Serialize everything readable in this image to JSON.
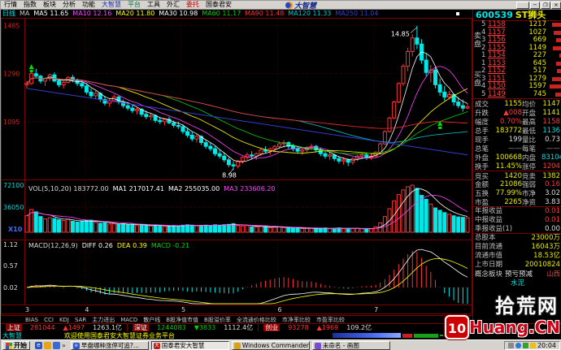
{
  "menu": {
    "items": [
      {
        "label": "行情",
        "color": "#000000"
      },
      {
        "label": "指数",
        "color": "#000000"
      },
      {
        "label": "板块",
        "color": "#000000"
      },
      {
        "label": "分析",
        "color": "#000000"
      },
      {
        "label": "功能",
        "color": "#000000"
      },
      {
        "label": "大智慧",
        "color": "#1a2fb0"
      },
      {
        "label": "平台",
        "color": "#0a7a4a"
      },
      {
        "label": "工具",
        "color": "#000000"
      },
      {
        "label": "外汇",
        "color": "#000000"
      },
      {
        "label": "委托",
        "color": "#c00000"
      },
      {
        "label": "国泰君安",
        "color": "#000000"
      }
    ],
    "brand": "大智慧",
    "window_buttons": {
      "minimize": "─",
      "restore": "❐",
      "close": "✕"
    }
  },
  "chart": {
    "period": "日线",
    "ma_legend": [
      {
        "t": "MA",
        "c": "#c8c8c8"
      },
      {
        "t": "MA5 11.65",
        "c": "#ffffff"
      },
      {
        "t": "MA10 12.16",
        "c": "#ff45ff"
      },
      {
        "t": "MA20 11.80",
        "c": "#ffff00"
      },
      {
        "t": "MA30 10.98",
        "c": "#ffffff"
      },
      {
        "t": "MA60 11.17",
        "c": "#00d000"
      },
      {
        "t": "MA90 11.48",
        "c": "#ff3030"
      },
      {
        "t": "MA120 11.33",
        "c": "#00c8c8"
      },
      {
        "t": "MA250 11.04",
        "c": "#2f3fd0"
      }
    ],
    "vol_legend": [
      {
        "t": "VOL(5,10,20) 183772.00",
        "c": "#d8d8d8"
      },
      {
        "t": "MA1 217017.41",
        "c": "#ffffff"
      },
      {
        "t": "MA2 255035.00",
        "c": "#ffffff"
      },
      {
        "t": "MA3 233606.20",
        "c": "#ff45ff"
      }
    ],
    "macd_legend": [
      {
        "t": "MACD(12,26,9)",
        "c": "#d8d8d8"
      },
      {
        "t": "DIFF 0.26",
        "c": "#ffffff"
      },
      {
        "t": "DEA 0.39",
        "c": "#ffff00"
      },
      {
        "t": "MACD -0.21",
        "c": "#00d000"
      }
    ],
    "price_axis": [
      {
        "t": "1485",
        "p": 14.85
      },
      {
        "t": "1290",
        "p": 12.9
      },
      {
        "t": "1095",
        "p": 10.95
      }
    ],
    "vol_axis": [
      "72100",
      "36050"
    ],
    "vol_mult": "X10",
    "macd_axis": [
      "1.12",
      "0.57",
      "0.02"
    ]
  },
  "chart_data": {
    "type": "candlestick",
    "title": "600539 ST狮头 日线",
    "ylim": [
      8.8,
      15.1
    ],
    "months": [
      {
        "label": "3",
        "i": 0
      },
      {
        "label": "4",
        "i": 13
      },
      {
        "label": "5",
        "i": 34
      },
      {
        "label": "6",
        "i": 55
      },
      {
        "label": "7",
        "i": 76
      }
    ],
    "annotations": [
      {
        "t": "14.85",
        "day": 85,
        "kind": "high"
      },
      {
        "t": "8.98",
        "day": 45,
        "kind": "low"
      }
    ],
    "markers": [
      {
        "day": 1,
        "price": 13.15
      },
      {
        "day": 90,
        "price": 10.85
      }
    ],
    "ma250_line": [
      [
        0,
        12.3
      ],
      [
        96,
        9.6
      ]
    ],
    "candles": [
      [
        12.45,
        12.6,
        12.3,
        12.5,
        210
      ],
      [
        12.5,
        12.95,
        12.45,
        12.9,
        290
      ],
      [
        12.9,
        13.1,
        12.7,
        12.8,
        260
      ],
      [
        12.8,
        12.85,
        12.5,
        12.6,
        200
      ],
      [
        12.6,
        12.75,
        12.4,
        12.7,
        170
      ],
      [
        12.7,
        12.9,
        12.6,
        12.85,
        185
      ],
      [
        12.85,
        12.95,
        12.55,
        12.6,
        175
      ],
      [
        12.6,
        12.7,
        12.35,
        12.45,
        160
      ],
      [
        12.45,
        12.6,
        12.3,
        12.55,
        150
      ],
      [
        12.55,
        12.8,
        12.5,
        12.75,
        165
      ],
      [
        12.75,
        12.85,
        12.55,
        12.65,
        140
      ],
      [
        12.65,
        12.7,
        12.4,
        12.5,
        130
      ],
      [
        12.5,
        12.6,
        12.3,
        12.4,
        135
      ],
      [
        12.4,
        12.5,
        12.05,
        12.15,
        150
      ],
      [
        12.15,
        12.3,
        11.9,
        12.0,
        155
      ],
      [
        12.0,
        12.2,
        11.85,
        12.1,
        125
      ],
      [
        12.1,
        12.15,
        11.75,
        11.85,
        115
      ],
      [
        11.85,
        12.0,
        11.6,
        11.7,
        120
      ],
      [
        11.7,
        11.9,
        11.55,
        11.8,
        105
      ],
      [
        11.8,
        12.05,
        11.75,
        11.95,
        110
      ],
      [
        11.95,
        12.0,
        11.65,
        11.75,
        100
      ],
      [
        11.75,
        11.85,
        11.5,
        11.6,
        105
      ],
      [
        11.6,
        11.75,
        11.4,
        11.5,
        95
      ],
      [
        11.5,
        11.65,
        11.3,
        11.4,
        100
      ],
      [
        11.4,
        11.55,
        11.25,
        11.45,
        85
      ],
      [
        11.45,
        11.5,
        11.15,
        11.25,
        95
      ],
      [
        11.25,
        11.4,
        11.05,
        11.15,
        90
      ],
      [
        11.15,
        11.3,
        11.0,
        11.2,
        80
      ],
      [
        11.2,
        11.25,
        10.9,
        11.0,
        90
      ],
      [
        11.0,
        11.15,
        10.85,
        10.95,
        85
      ],
      [
        10.95,
        11.1,
        10.8,
        11.05,
        75
      ],
      [
        11.05,
        11.15,
        10.85,
        10.9,
        80
      ],
      [
        10.9,
        11.0,
        10.7,
        10.8,
        85
      ],
      [
        10.8,
        10.95,
        10.65,
        10.75,
        80
      ],
      [
        10.75,
        10.85,
        10.45,
        10.55,
        90
      ],
      [
        10.55,
        10.7,
        10.3,
        10.4,
        95
      ],
      [
        10.4,
        10.55,
        10.15,
        10.25,
        90
      ],
      [
        10.25,
        10.45,
        10.1,
        10.35,
        80
      ],
      [
        10.35,
        10.4,
        10.0,
        10.1,
        85
      ],
      [
        10.1,
        10.2,
        9.85,
        9.95,
        90
      ],
      [
        9.95,
        10.1,
        9.75,
        9.85,
        85
      ],
      [
        9.85,
        9.95,
        9.55,
        9.65,
        95
      ],
      [
        9.65,
        9.8,
        9.45,
        9.55,
        90
      ],
      [
        9.55,
        9.7,
        9.3,
        9.4,
        95
      ],
      [
        9.4,
        9.5,
        9.1,
        9.2,
        100
      ],
      [
        9.2,
        9.35,
        8.98,
        9.15,
        110
      ],
      [
        9.15,
        9.4,
        9.05,
        9.35,
        85
      ],
      [
        9.35,
        9.55,
        9.25,
        9.5,
        80
      ],
      [
        9.5,
        9.7,
        9.4,
        9.6,
        85
      ],
      [
        9.6,
        9.75,
        9.45,
        9.55,
        70
      ],
      [
        9.55,
        9.7,
        9.4,
        9.65,
        65
      ],
      [
        9.65,
        9.85,
        9.55,
        9.8,
        75
      ],
      [
        9.8,
        9.95,
        9.65,
        9.75,
        70
      ],
      [
        9.75,
        9.9,
        9.6,
        9.85,
        60
      ],
      [
        9.85,
        10.0,
        9.7,
        9.95,
        65
      ],
      [
        9.95,
        10.15,
        9.85,
        10.05,
        70
      ],
      [
        10.05,
        10.2,
        9.9,
        10.1,
        60
      ],
      [
        10.1,
        10.15,
        9.85,
        9.95,
        55
      ],
      [
        9.95,
        10.05,
        9.75,
        9.85,
        50
      ],
      [
        9.85,
        9.95,
        9.65,
        9.75,
        55
      ],
      [
        9.75,
        9.9,
        9.6,
        9.8,
        48
      ],
      [
        9.8,
        9.95,
        9.7,
        9.9,
        50
      ],
      [
        9.9,
        10.05,
        9.8,
        9.95,
        52
      ],
      [
        9.95,
        10.0,
        9.7,
        9.8,
        45
      ],
      [
        9.8,
        9.9,
        9.55,
        9.65,
        50
      ],
      [
        9.65,
        9.75,
        9.45,
        9.55,
        55
      ],
      [
        9.55,
        9.7,
        9.4,
        9.6,
        45
      ],
      [
        9.6,
        9.65,
        9.35,
        9.45,
        50
      ],
      [
        9.45,
        9.55,
        9.25,
        9.35,
        55
      ],
      [
        9.35,
        9.5,
        9.2,
        9.4,
        45
      ],
      [
        9.4,
        9.45,
        9.15,
        9.3,
        50
      ],
      [
        9.3,
        9.5,
        9.2,
        9.45,
        48
      ],
      [
        9.45,
        9.6,
        9.35,
        9.55,
        50
      ],
      [
        9.55,
        9.7,
        9.45,
        9.6,
        45
      ],
      [
        9.6,
        9.7,
        9.4,
        9.5,
        42
      ],
      [
        9.5,
        9.65,
        9.4,
        9.55,
        45
      ],
      [
        9.55,
        9.75,
        9.5,
        9.7,
        70
      ],
      [
        9.7,
        10.1,
        9.65,
        10.05,
        120
      ],
      [
        10.05,
        10.6,
        10.0,
        10.55,
        200
      ],
      [
        10.55,
        11.15,
        10.5,
        11.1,
        300
      ],
      [
        11.1,
        11.8,
        11.05,
        11.75,
        400
      ],
      [
        11.75,
        12.55,
        11.7,
        12.5,
        480
      ],
      [
        12.5,
        13.3,
        12.4,
        13.2,
        540
      ],
      [
        13.2,
        13.95,
        13.0,
        13.8,
        580
      ],
      [
        13.8,
        14.5,
        13.6,
        14.35,
        600
      ],
      [
        14.35,
        14.85,
        13.9,
        14.1,
        560
      ],
      [
        14.1,
        14.3,
        13.3,
        13.45,
        470
      ],
      [
        13.45,
        13.7,
        12.8,
        12.95,
        420
      ],
      [
        12.95,
        13.25,
        12.55,
        13.05,
        360
      ],
      [
        13.05,
        13.15,
        12.3,
        12.45,
        310
      ],
      [
        12.45,
        12.7,
        12.0,
        12.15,
        280
      ],
      [
        12.15,
        12.4,
        11.8,
        11.95,
        250
      ],
      [
        11.95,
        12.2,
        11.85,
        12.05,
        230
      ],
      [
        12.05,
        12.1,
        11.6,
        11.75,
        210
      ],
      [
        11.75,
        11.95,
        11.5,
        11.6,
        195
      ],
      [
        11.6,
        11.85,
        11.36,
        11.5,
        190
      ],
      [
        11.5,
        11.7,
        11.45,
        11.55,
        184
      ]
    ]
  },
  "quote_panel": {
    "code": "600539",
    "name": "ST狮头",
    "sell_label": "卖盘",
    "buy_label": "买盘",
    "sell": [
      [
        "5",
        "1158",
        "1217"
      ],
      [
        "4",
        "1157",
        "1027"
      ],
      [
        "3",
        "1156",
        "669"
      ],
      [
        "2",
        "1155",
        "1149"
      ],
      [
        "1",
        "1154",
        "227"
      ]
    ],
    "buy": [
      [
        "1",
        "1153",
        "645"
      ],
      [
        "2",
        "1152",
        "517"
      ],
      [
        "3",
        "1151",
        "1279"
      ],
      [
        "4",
        "1150",
        "1597"
      ],
      [
        "5",
        "1149",
        "745"
      ]
    ],
    "info": [
      [
        "成交",
        "1155",
        "y",
        "均价",
        "1147",
        "y",
        false
      ],
      [
        "升跌",
        "▲008",
        "r",
        "开盘",
        "1141",
        "y",
        false
      ],
      [
        "幅度",
        "0.70%",
        "r",
        "最高",
        "1158",
        "r",
        false
      ],
      [
        "总手",
        "183772",
        "y",
        "最低",
        "1136",
        "c",
        false
      ],
      [
        "现手",
        "199",
        "w",
        "量比",
        "0.73",
        "w",
        false
      ],
      [
        "总笔",
        "——",
        "g",
        "每笔",
        "——",
        "g",
        false
      ],
      [
        "外盘",
        "100668",
        "y",
        "内盘",
        "83104",
        "c",
        false
      ],
      [
        "换手",
        "11.45%",
        "y",
        "涨停",
        "1204",
        "r",
        false
      ],
      [
        "竞买",
        "1420",
        "y",
        "竞卖",
        "1382",
        "y",
        true
      ],
      [
        "金额",
        "21086",
        "y",
        "强弱",
        "0.16",
        "r",
        false
      ],
      [
        "五换",
        "77.99%",
        "y",
        "市净",
        "3.02",
        "w",
        false
      ],
      [
        "市盈",
        "2265",
        "y",
        "净资",
        "3.83",
        "w",
        false
      ]
    ],
    "wide": [
      [
        "年报收益",
        "0.01",
        "r",
        true
      ],
      [
        "中报收益",
        "0.01",
        "r",
        false
      ],
      [
        "季报收益(1)",
        "0.00",
        "w",
        false
      ],
      [
        "总股本",
        "23000万",
        "y",
        true
      ],
      [
        "目前流通",
        "16043万",
        "y",
        false
      ],
      [
        "流通市值",
        "18.53亿",
        "y",
        false
      ],
      [
        "上市日期",
        "20010824",
        "y",
        false
      ]
    ],
    "concept": {
      "label": "概念板块",
      "v1": "预亏预减",
      "v2": "山西",
      "v3": "水泥"
    }
  },
  "tabs": [
    "BIAS",
    "CCI",
    "KDJ",
    "SAR",
    "主力进出",
    "MACD",
    "散户线",
    "B股净值市值",
    "B股溢价率",
    "全流通价格比较",
    "市净率比较",
    "市盈率比较"
  ],
  "status_bar": [
    {
      "label": "上证",
      "value": "281044",
      "vc": "#ff3232",
      "change": "▲1497",
      "cc": "#ff3232",
      "amount": "1263.1亿"
    },
    {
      "label": "深证",
      "value": "1244083",
      "vc": "#00cc00",
      "change": "▼3833",
      "cc": "#00cc00",
      "amount": "1112.4亿"
    },
    {
      "label": "创业",
      "value": "93278",
      "vc": "#ff3232",
      "change": "▲1969",
      "cc": "#ff3232",
      "amount": "109.2亿"
    }
  ],
  "message_bar": {
    "app": "大智慧",
    "text": "欢迎使用国泰君安大智慧证券业务平台"
  },
  "taskbar": {
    "start": "开始",
    "tasks": [
      {
        "t": "早盘哪种涨停可追?...",
        "icon": "ie",
        "active": false
      },
      {
        "t": "国泰君安大智慧",
        "icon": "dzh",
        "active": true
      },
      {
        "t": "Windows Commander 5...",
        "icon": "wc",
        "active": false
      },
      {
        "t": "未命名 - 画图",
        "icon": "paint",
        "active": false
      }
    ],
    "time": "20:04"
  },
  "watermark": {
    "site": "拾荒网",
    "logo": "10",
    "domain": "Huang.CN"
  },
  "colors": {
    "up": "#ff3434",
    "down": "#00e8e8",
    "frame": "#7a0202",
    "axis_red": "#d02020",
    "axis_cyan": "#00d8d8"
  }
}
